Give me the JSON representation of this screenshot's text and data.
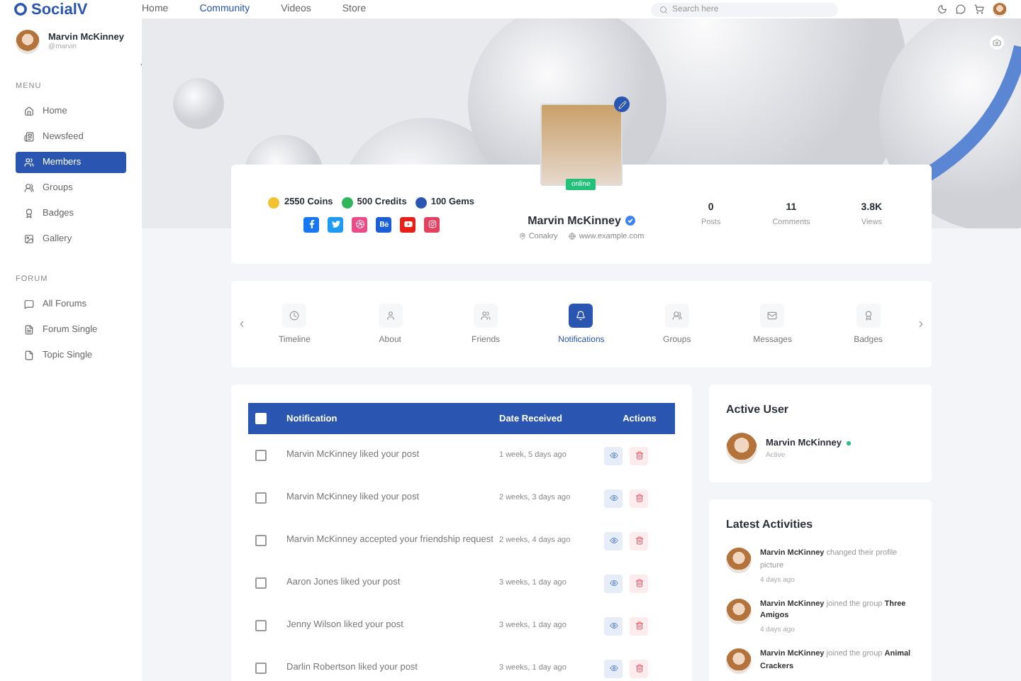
{
  "header": {
    "logo": "SocialV",
    "nav": [
      {
        "label": "Home",
        "selected": false
      },
      {
        "label": "Community",
        "selected": true
      },
      {
        "label": "Videos",
        "selected": false
      },
      {
        "label": "Store",
        "selected": false
      }
    ],
    "search": {
      "placeholder": "Search here"
    }
  },
  "sidebar": {
    "user": {
      "name": "Marvin McKinney",
      "handle": "@marvin"
    },
    "sections": [
      {
        "title": "MENU",
        "items": [
          {
            "label": "Home",
            "selected": false
          },
          {
            "label": "Newsfeed",
            "selected": false
          },
          {
            "label": "Members",
            "selected": true
          },
          {
            "label": "Groups",
            "selected": false
          },
          {
            "label": "Badges",
            "selected": false
          },
          {
            "label": "Gallery",
            "selected": false
          }
        ]
      },
      {
        "title": "FORUM",
        "items": [
          {
            "label": "All Forums",
            "selected": false
          },
          {
            "label": "Forum Single",
            "selected": false
          },
          {
            "label": "Topic Single",
            "selected": false
          }
        ]
      }
    ]
  },
  "profile": {
    "currencies": [
      {
        "label": "2550 Coins",
        "color": "#f2c230"
      },
      {
        "label": "500 Credits",
        "color": "#2fb55a"
      },
      {
        "label": "100 Gems",
        "color": "#2a55b0"
      }
    ],
    "socials": [
      {
        "kind": "facebook",
        "color": "#1877f2"
      },
      {
        "kind": "twitter",
        "color": "#1d9bf0"
      },
      {
        "kind": "dribbble",
        "color": "#ea4c89"
      },
      {
        "kind": "behance",
        "color": "#1a5fd6"
      },
      {
        "kind": "youtube",
        "color": "#e62117"
      },
      {
        "kind": "instagram",
        "color": "#e4405f"
      }
    ],
    "status": "online",
    "name": "Marvin McKinney",
    "verified": true,
    "location": "Conakry",
    "website": "www.example.com",
    "stats": [
      {
        "value": "0",
        "label": "Posts"
      },
      {
        "value": "11",
        "label": "Comments"
      },
      {
        "value": "3.8K",
        "label": "Views"
      }
    ]
  },
  "tabs": [
    {
      "label": "Timeline",
      "selected": false
    },
    {
      "label": "About",
      "selected": false
    },
    {
      "label": "Friends",
      "selected": false
    },
    {
      "label": "Notifications",
      "selected": true
    },
    {
      "label": "Groups",
      "selected": false
    },
    {
      "label": "Messages",
      "selected": false
    },
    {
      "label": "Badges",
      "selected": false
    }
  ],
  "notifications": {
    "columns": [
      "Notification",
      "Date Received",
      "Actions"
    ],
    "select_all": false,
    "rows": [
      {
        "text": "Marvin McKinney liked your post",
        "date": "1 week, 5 days ago",
        "checked": false
      },
      {
        "text": "Marvin McKinney liked your post",
        "date": "2 weeks, 3 days ago",
        "checked": false
      },
      {
        "text": "Marvin McKinney accepted your friendship request",
        "date": "2 weeks, 4 days ago",
        "checked": false
      },
      {
        "text": "Aaron Jones liked your post",
        "date": "3 weeks, 1 day ago",
        "checked": false
      },
      {
        "text": "Jenny Wilson liked your post",
        "date": "3 weeks, 1 day ago",
        "checked": false
      },
      {
        "text": "Darlin Robertson liked your post",
        "date": "3 weeks, 1 day ago",
        "checked": false
      }
    ]
  },
  "active_user": {
    "title": "Active User",
    "name": "Marvin McKinney",
    "status": "Active",
    "online": true
  },
  "activities": {
    "title": "Latest Activities",
    "items": [
      {
        "text": "**Marvin McKinney** changed their profile picture",
        "time": "4 days ago"
      },
      {
        "text": "**Marvin McKinney** joined the group **Three Amigos**",
        "time": "4 days ago"
      },
      {
        "text": "**Marvin McKinney** joined the group **Animal Crackers**"
      }
    ]
  }
}
